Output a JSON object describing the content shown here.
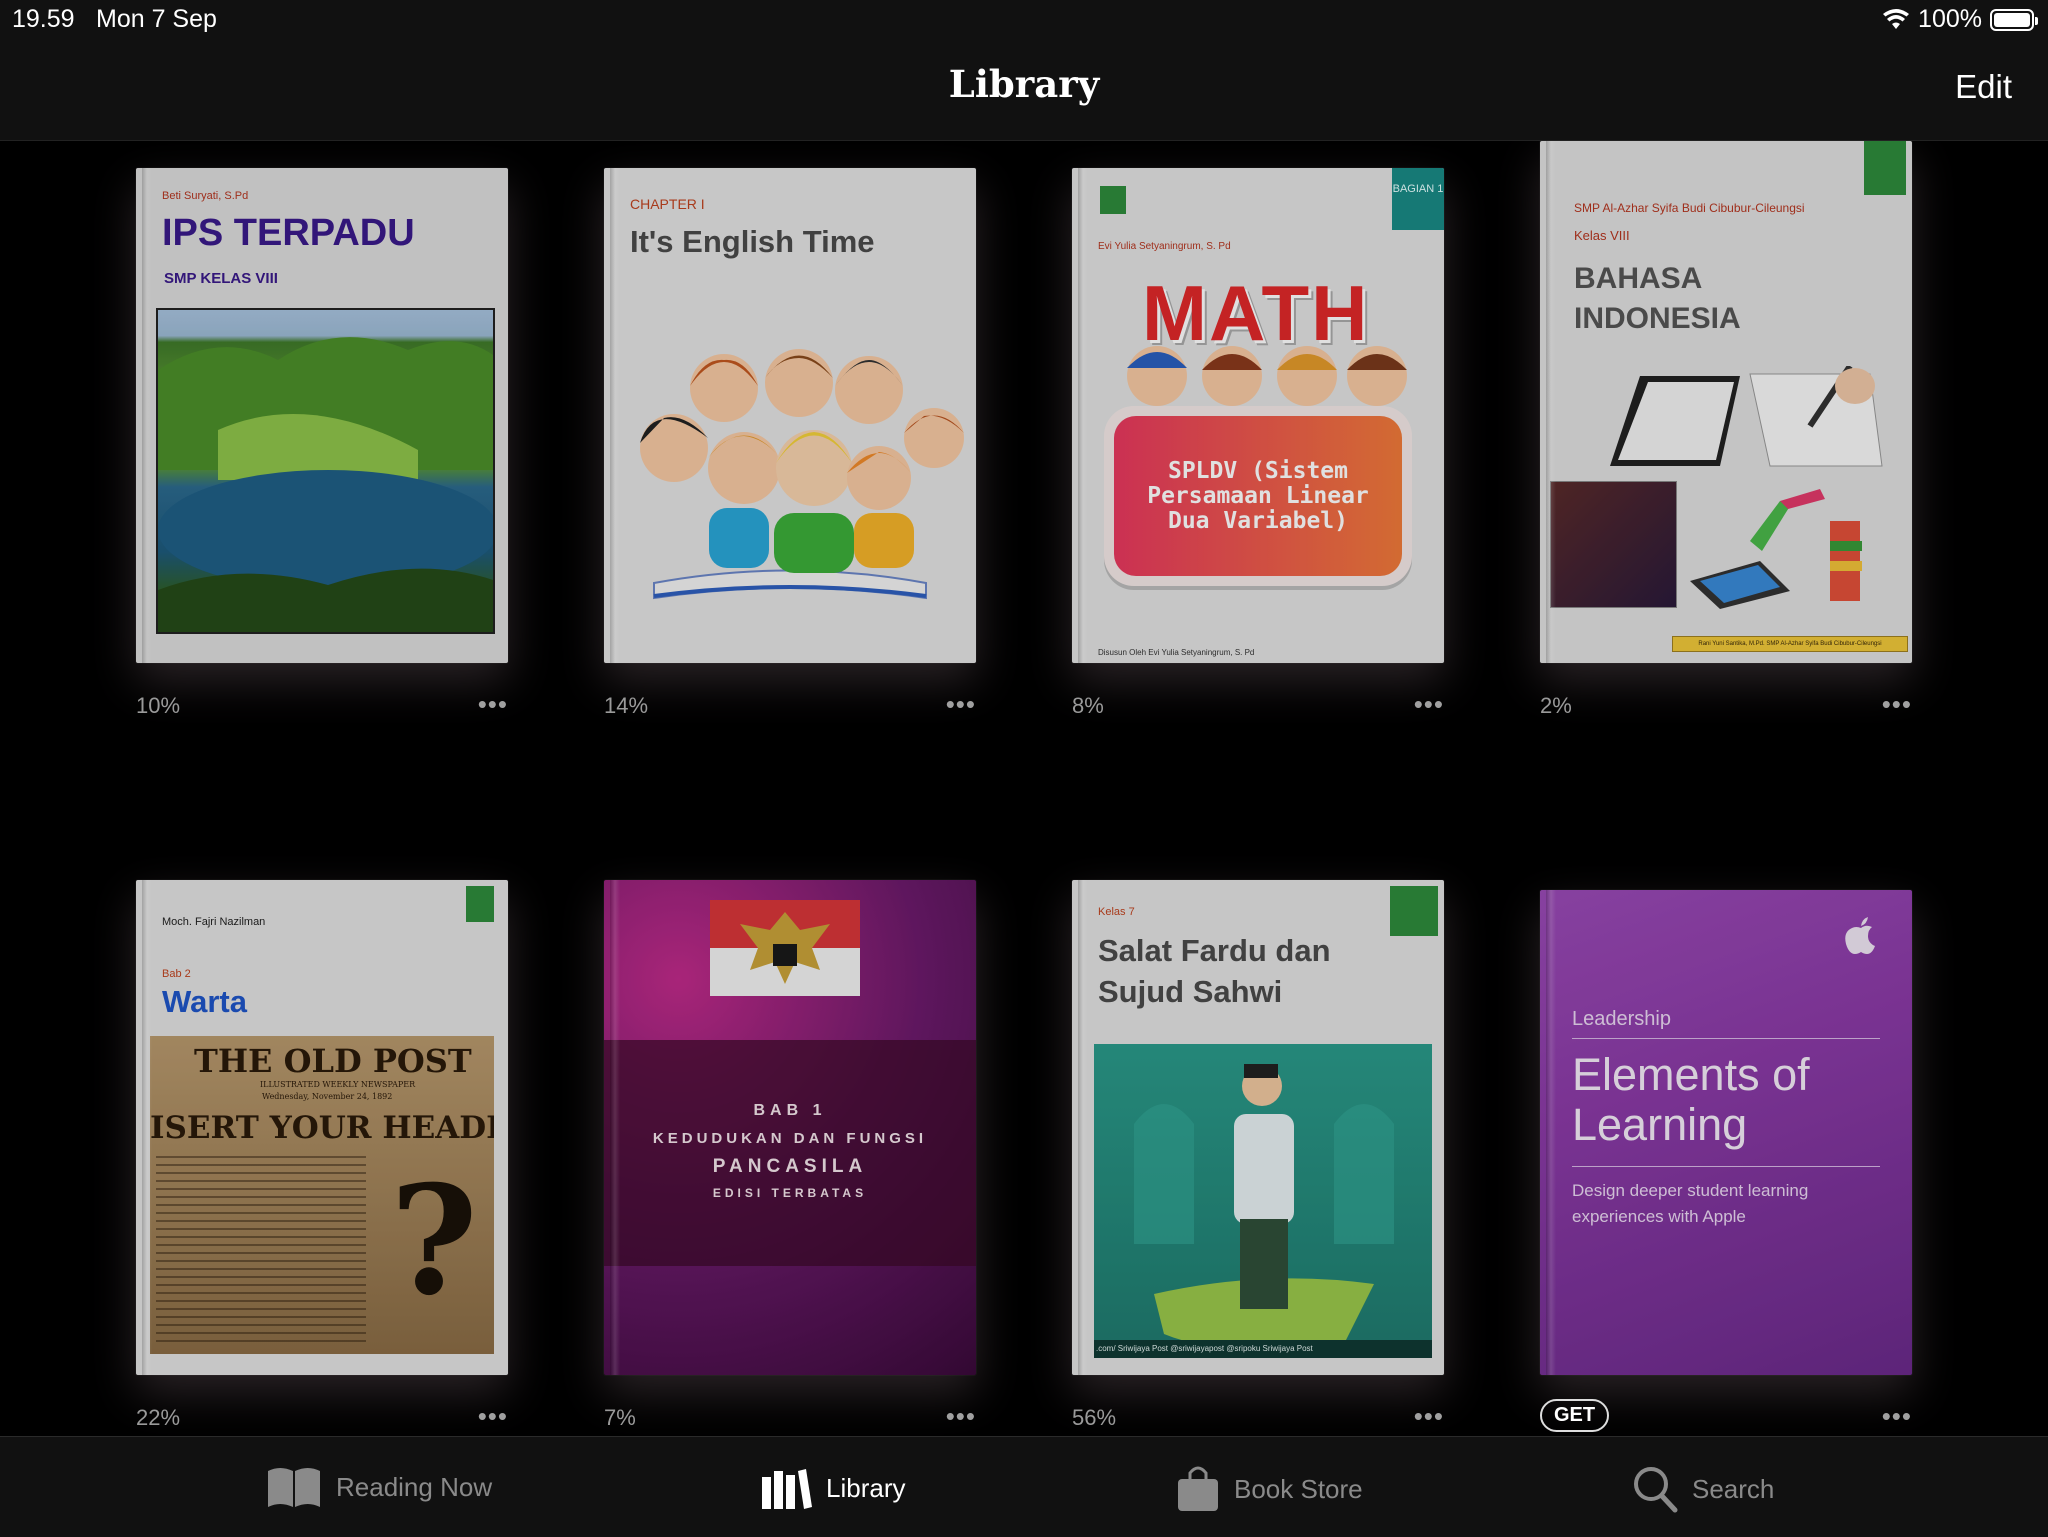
{
  "status_bar": {
    "time": "19.59",
    "date": "Mon 7 Sep",
    "battery": "100%"
  },
  "nav": {
    "title": "Library",
    "edit_label": "Edit"
  },
  "books": [
    {
      "author": "Beti Suryati, S.Pd",
      "title": "IPS TERPADU",
      "subtitle": "SMP KELAS VIII",
      "progress": "10%",
      "more": "•••"
    },
    {
      "chapter": "CHAPTER I",
      "title": "It's English Time",
      "progress": "14%",
      "more": "•••"
    },
    {
      "author": "Evi Yulia Setyaningrum, S. Pd",
      "badge": "BAGIAN 1",
      "title": "MATH",
      "subtitle": "SPLDV (Sistem Persamaan Linear Dua Variabel)",
      "footer": "Disusun Oleh Evi Yulia Setyaningrum, S. Pd",
      "progress": "8%",
      "more": "•••"
    },
    {
      "school": "SMP Al-Azhar Syifa Budi Cibubur-Cileungsi",
      "grade": "Kelas VIII",
      "title": "BAHASA INDONESIA",
      "footer": "Rani Yuni Santika, M.Pd. SMP Al-Azhar Syifa Budi Cibubur-Cileungsi",
      "progress": "2%",
      "more": "•••"
    },
    {
      "author": "Moch. Fajri Nazilman",
      "chapter": "Bab 2",
      "title": "Warta",
      "paper_name": "THE OLD POST",
      "paper_sub": "ILLUSTRATED WEEKLY NEWSPAPER",
      "paper_date": "Wednesday, November 24, 1892",
      "headline": "ISERT YOUR HEADLIN",
      "progress": "22%",
      "more": "•••"
    },
    {
      "chapter": "BAB 1",
      "title": "KEDUDUKAN DAN FUNGSI",
      "title2": "PANCASILA",
      "edition": "EDISI TERBATAS",
      "progress": "7%",
      "more": "•••"
    },
    {
      "grade": "Kelas 7",
      "title": "Salat Fardu dan Sujud Sahwi",
      "footer": ".com/ Sriwijaya Post @sriwijayapost @sripoku Sriwijaya Post",
      "progress": "56%",
      "more": "•••"
    },
    {
      "category": "Leadership",
      "title": "Elements of Learning",
      "subtitle": "Design deeper student learning experiences with Apple",
      "get_label": "GET",
      "more": "•••"
    }
  ],
  "tabs": [
    {
      "label": "Reading Now",
      "icon": "book-open-icon"
    },
    {
      "label": "Library",
      "icon": "library-icon",
      "active": true
    },
    {
      "label": "Book Store",
      "icon": "shopping-bag-icon"
    },
    {
      "label": "Search",
      "icon": "search-icon"
    }
  ]
}
